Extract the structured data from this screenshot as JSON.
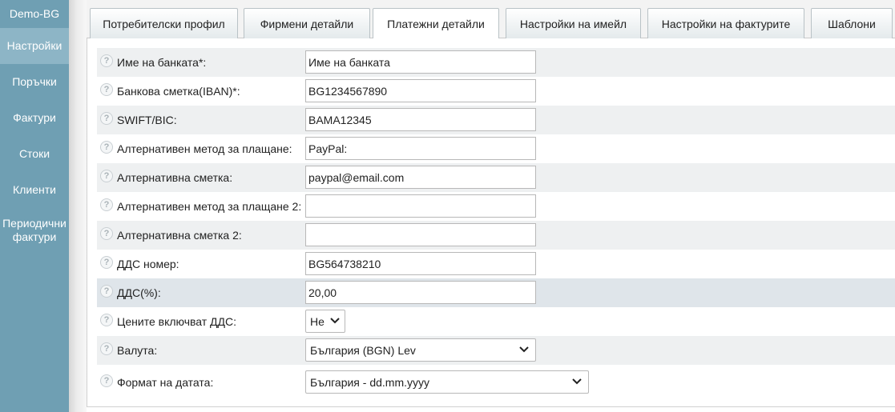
{
  "sidebar": {
    "brand": "Demo-BG",
    "items": [
      {
        "label": "Настройки"
      },
      {
        "label": "Поръчки"
      },
      {
        "label": "Фактури"
      },
      {
        "label": "Стоки"
      },
      {
        "label": "Клиенти"
      },
      {
        "label": "Периодични фактури"
      }
    ],
    "active_index": 0
  },
  "tabs": [
    {
      "label": "Потребителски профил"
    },
    {
      "label": "Фирмени детайли"
    },
    {
      "label": "Платежни детайли"
    },
    {
      "label": "Настройки на имейл"
    },
    {
      "label": "Настройки на фактурите"
    },
    {
      "label": "Шаблони"
    }
  ],
  "active_tab": "Платежни детайли",
  "form": {
    "help_glyph": "?",
    "rows": [
      {
        "label": "Име на банката*:",
        "value": "Име на банката"
      },
      {
        "label": "Банкова сметка(IBAN)*:",
        "value": "BG1234567890"
      },
      {
        "label": "SWIFT/BIC:",
        "value": "BAMA12345"
      },
      {
        "label": "Алтернативен метод за плащане:",
        "value": "PayPal:"
      },
      {
        "label": "Алтернативна сметка:",
        "value": "paypal@email.com"
      },
      {
        "label": "Алтернативен метод за плащане 2:",
        "value": ""
      },
      {
        "label": "Алтернативна сметка 2:",
        "value": ""
      },
      {
        "label": "ДДС номер:",
        "value": "BG564738210"
      },
      {
        "label": "ДДС(%):",
        "value": "20,00"
      },
      {
        "label": "Цените включват ДДС:",
        "value": "Не"
      },
      {
        "label": "Валута:",
        "value": "България (BGN) Lev"
      },
      {
        "label": "Формат на датата:",
        "value": "България - dd.mm.yyyy"
      }
    ]
  },
  "colors": {
    "sidebar_bg": "#6f9fb3",
    "sidebar_active": "#8db5c6",
    "row_shaded": "#eef0f1",
    "row_highlight": "#dfe5ea"
  }
}
